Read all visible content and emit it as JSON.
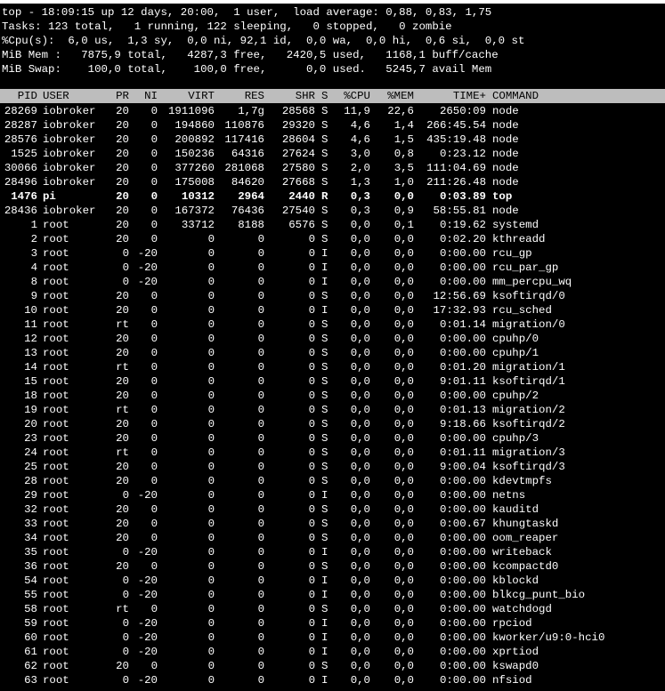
{
  "summary": [
    "top - 18:09:15 up 12 days, 20:00,  1 user,  load average: 0,88, 0,83, 1,75",
    "Tasks: 123 total,   1 running, 122 sleeping,   0 stopped,   0 zombie",
    "%Cpu(s):  6,0 us,  1,3 sy,  0,0 ni, 92,1 id,  0,0 wa,  0,0 hi,  0,6 si,  0,0 st",
    "MiB Mem :   7875,9 total,   4287,3 free,   2420,5 used,   1168,1 buff/cache",
    "MiB Swap:    100,0 total,    100,0 free,      0,0 used.   5245,7 avail Mem"
  ],
  "columns": [
    "PID",
    "USER",
    "PR",
    "NI",
    "VIRT",
    "RES",
    "SHR",
    "S",
    "%CPU",
    "%MEM",
    "TIME+",
    "COMMAND"
  ],
  "processes": [
    [
      "28269",
      "iobroker",
      "20",
      "0",
      "1911096",
      "1,7g",
      "28568",
      "S",
      "11,9",
      "22,6",
      "2650:09",
      "node"
    ],
    [
      "28287",
      "iobroker",
      "20",
      "0",
      "194860",
      "110876",
      "29320",
      "S",
      "4,6",
      "1,4",
      "266:45.54",
      "node"
    ],
    [
      "28576",
      "iobroker",
      "20",
      "0",
      "200892",
      "117416",
      "28604",
      "S",
      "4,6",
      "1,5",
      "435:19.48",
      "node"
    ],
    [
      "1525",
      "iobroker",
      "20",
      "0",
      "150236",
      "64316",
      "27624",
      "S",
      "3,0",
      "0,8",
      "0:23.12",
      "node"
    ],
    [
      "30066",
      "iobroker",
      "20",
      "0",
      "377260",
      "281068",
      "27580",
      "S",
      "2,0",
      "3,5",
      "111:04.69",
      "node"
    ],
    [
      "28496",
      "iobroker",
      "20",
      "0",
      "175008",
      "84620",
      "27668",
      "S",
      "1,3",
      "1,0",
      "211:26.48",
      "node"
    ],
    [
      "1476",
      "pi",
      "20",
      "0",
      "10312",
      "2964",
      "2440",
      "R",
      "0,3",
      "0,0",
      "0:03.89",
      "top"
    ],
    [
      "28436",
      "iobroker",
      "20",
      "0",
      "167372",
      "76436",
      "27540",
      "S",
      "0,3",
      "0,9",
      "58:55.81",
      "node"
    ],
    [
      "1",
      "root",
      "20",
      "0",
      "33712",
      "8188",
      "6576",
      "S",
      "0,0",
      "0,1",
      "0:19.62",
      "systemd"
    ],
    [
      "2",
      "root",
      "20",
      "0",
      "0",
      "0",
      "0",
      "S",
      "0,0",
      "0,0",
      "0:02.20",
      "kthreadd"
    ],
    [
      "3",
      "root",
      "0",
      "-20",
      "0",
      "0",
      "0",
      "I",
      "0,0",
      "0,0",
      "0:00.00",
      "rcu_gp"
    ],
    [
      "4",
      "root",
      "0",
      "-20",
      "0",
      "0",
      "0",
      "I",
      "0,0",
      "0,0",
      "0:00.00",
      "rcu_par_gp"
    ],
    [
      "8",
      "root",
      "0",
      "-20",
      "0",
      "0",
      "0",
      "I",
      "0,0",
      "0,0",
      "0:00.00",
      "mm_percpu_wq"
    ],
    [
      "9",
      "root",
      "20",
      "0",
      "0",
      "0",
      "0",
      "S",
      "0,0",
      "0,0",
      "12:56.69",
      "ksoftirqd/0"
    ],
    [
      "10",
      "root",
      "20",
      "0",
      "0",
      "0",
      "0",
      "I",
      "0,0",
      "0,0",
      "17:32.93",
      "rcu_sched"
    ],
    [
      "11",
      "root",
      "rt",
      "0",
      "0",
      "0",
      "0",
      "S",
      "0,0",
      "0,0",
      "0:01.14",
      "migration/0"
    ],
    [
      "12",
      "root",
      "20",
      "0",
      "0",
      "0",
      "0",
      "S",
      "0,0",
      "0,0",
      "0:00.00",
      "cpuhp/0"
    ],
    [
      "13",
      "root",
      "20",
      "0",
      "0",
      "0",
      "0",
      "S",
      "0,0",
      "0,0",
      "0:00.00",
      "cpuhp/1"
    ],
    [
      "14",
      "root",
      "rt",
      "0",
      "0",
      "0",
      "0",
      "S",
      "0,0",
      "0,0",
      "0:01.20",
      "migration/1"
    ],
    [
      "15",
      "root",
      "20",
      "0",
      "0",
      "0",
      "0",
      "S",
      "0,0",
      "0,0",
      "9:01.11",
      "ksoftirqd/1"
    ],
    [
      "18",
      "root",
      "20",
      "0",
      "0",
      "0",
      "0",
      "S",
      "0,0",
      "0,0",
      "0:00.00",
      "cpuhp/2"
    ],
    [
      "19",
      "root",
      "rt",
      "0",
      "0",
      "0",
      "0",
      "S",
      "0,0",
      "0,0",
      "0:01.13",
      "migration/2"
    ],
    [
      "20",
      "root",
      "20",
      "0",
      "0",
      "0",
      "0",
      "S",
      "0,0",
      "0,0",
      "9:18.66",
      "ksoftirqd/2"
    ],
    [
      "23",
      "root",
      "20",
      "0",
      "0",
      "0",
      "0",
      "S",
      "0,0",
      "0,0",
      "0:00.00",
      "cpuhp/3"
    ],
    [
      "24",
      "root",
      "rt",
      "0",
      "0",
      "0",
      "0",
      "S",
      "0,0",
      "0,0",
      "0:01.11",
      "migration/3"
    ],
    [
      "25",
      "root",
      "20",
      "0",
      "0",
      "0",
      "0",
      "S",
      "0,0",
      "0,0",
      "9:00.04",
      "ksoftirqd/3"
    ],
    [
      "28",
      "root",
      "20",
      "0",
      "0",
      "0",
      "0",
      "S",
      "0,0",
      "0,0",
      "0:00.00",
      "kdevtmpfs"
    ],
    [
      "29",
      "root",
      "0",
      "-20",
      "0",
      "0",
      "0",
      "I",
      "0,0",
      "0,0",
      "0:00.00",
      "netns"
    ],
    [
      "32",
      "root",
      "20",
      "0",
      "0",
      "0",
      "0",
      "S",
      "0,0",
      "0,0",
      "0:00.00",
      "kauditd"
    ],
    [
      "33",
      "root",
      "20",
      "0",
      "0",
      "0",
      "0",
      "S",
      "0,0",
      "0,0",
      "0:00.67",
      "khungtaskd"
    ],
    [
      "34",
      "root",
      "20",
      "0",
      "0",
      "0",
      "0",
      "S",
      "0,0",
      "0,0",
      "0:00.00",
      "oom_reaper"
    ],
    [
      "35",
      "root",
      "0",
      "-20",
      "0",
      "0",
      "0",
      "I",
      "0,0",
      "0,0",
      "0:00.00",
      "writeback"
    ],
    [
      "36",
      "root",
      "20",
      "0",
      "0",
      "0",
      "0",
      "S",
      "0,0",
      "0,0",
      "0:00.00",
      "kcompactd0"
    ],
    [
      "54",
      "root",
      "0",
      "-20",
      "0",
      "0",
      "0",
      "I",
      "0,0",
      "0,0",
      "0:00.00",
      "kblockd"
    ],
    [
      "55",
      "root",
      "0",
      "-20",
      "0",
      "0",
      "0",
      "I",
      "0,0",
      "0,0",
      "0:00.00",
      "blkcg_punt_bio"
    ],
    [
      "58",
      "root",
      "rt",
      "0",
      "0",
      "0",
      "0",
      "S",
      "0,0",
      "0,0",
      "0:00.00",
      "watchdogd"
    ],
    [
      "59",
      "root",
      "0",
      "-20",
      "0",
      "0",
      "0",
      "I",
      "0,0",
      "0,0",
      "0:00.00",
      "rpciod"
    ],
    [
      "60",
      "root",
      "0",
      "-20",
      "0",
      "0",
      "0",
      "I",
      "0,0",
      "0,0",
      "0:00.00",
      "kworker/u9:0-hci0"
    ],
    [
      "61",
      "root",
      "0",
      "-20",
      "0",
      "0",
      "0",
      "I",
      "0,0",
      "0,0",
      "0:00.00",
      "xprtiod"
    ],
    [
      "62",
      "root",
      "20",
      "0",
      "0",
      "0",
      "0",
      "S",
      "0,0",
      "0,0",
      "0:00.00",
      "kswapd0"
    ],
    [
      "63",
      "root",
      "0",
      "-20",
      "0",
      "0",
      "0",
      "I",
      "0,0",
      "0,0",
      "0:00.00",
      "nfsiod"
    ]
  ],
  "highlighted_pid": "1476",
  "colors": {
    "background": "#000000",
    "text": "#ffffff",
    "header_bg": "#bdbdbd",
    "header_text": "#000000"
  }
}
